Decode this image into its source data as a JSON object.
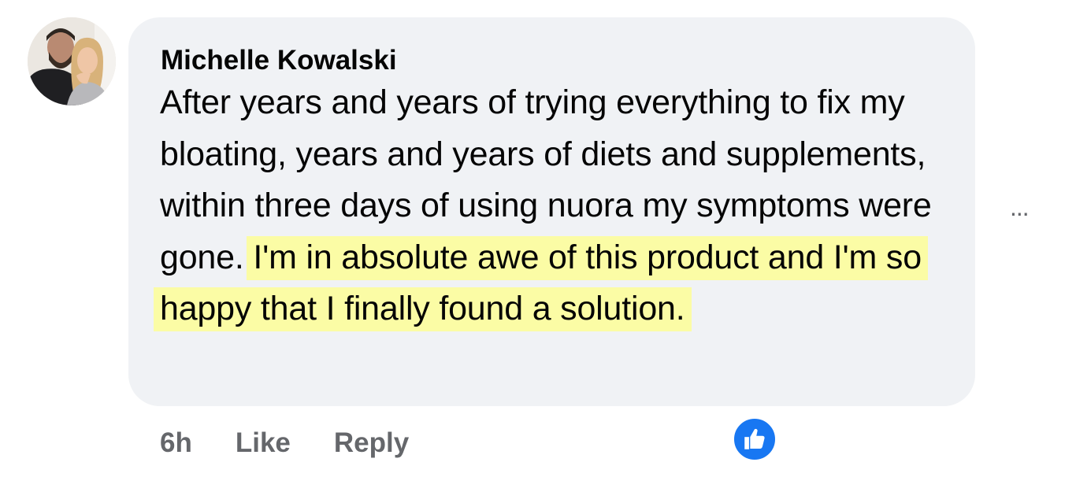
{
  "comment": {
    "author": "Michelle Kowalski",
    "text_plain": "After years and years of trying everything to fix my bloating, years and years of diets and supplements, within three days of using nuora my symptoms were gone. ",
    "text_highlight": "I'm in absolute awe of this product and I'm so happy that I finally found a solution.",
    "highlight_color": "#fbfca5"
  },
  "actions": {
    "time": "6h",
    "like_label": "Like",
    "reply_label": "Reply"
  },
  "more_options": "...",
  "reaction": {
    "icon": "thumbs-up-icon",
    "color": "#1877f2"
  },
  "colors": {
    "bubble": "#f0f2f5",
    "secondary_text": "#65676b"
  }
}
